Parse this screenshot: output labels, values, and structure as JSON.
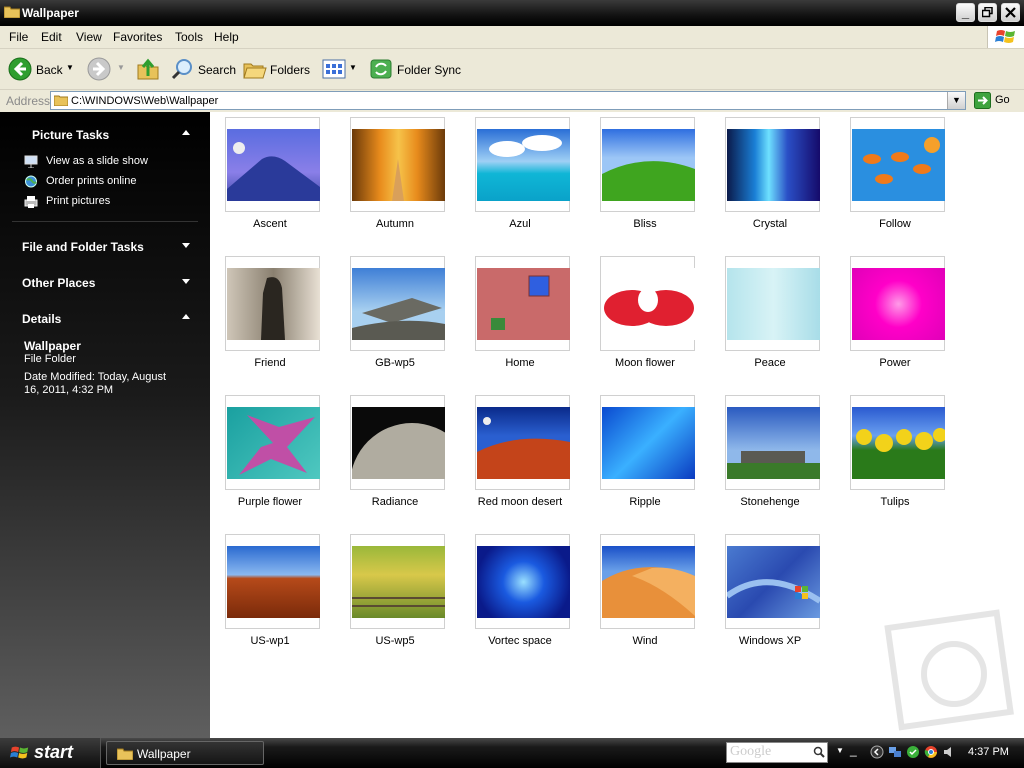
{
  "window": {
    "title": "Wallpaper"
  },
  "menu": [
    "File",
    "Edit",
    "View",
    "Favorites",
    "Tools",
    "Help"
  ],
  "toolbar": {
    "back_label": "Back",
    "search_label": "Search",
    "folders_label": "Folders",
    "sync_label": "Folder Sync"
  },
  "address": {
    "label": "Address",
    "value": "C:\\WINDOWS\\Web\\Wallpaper",
    "go_label": "Go"
  },
  "sidebar": {
    "picture_tasks": {
      "title": "Picture Tasks",
      "items": [
        "View as a slide show",
        "Order prints online",
        "Print pictures"
      ]
    },
    "file_folder_tasks": {
      "title": "File and Folder Tasks"
    },
    "other_places": {
      "title": "Other Places"
    },
    "details": {
      "title": "Details",
      "name": "Wallpaper",
      "type": "File Folder",
      "modified": "Date Modified: Today, August 16, 2011, 4:32 PM"
    }
  },
  "files": [
    "Ascent",
    "Autumn",
    "Azul",
    "Bliss",
    "Crystal",
    "Follow",
    "Friend",
    "GB-wp5",
    "Home",
    "Moon flower",
    "Peace",
    "Power",
    "Purple flower",
    "Radiance",
    "Red moon desert",
    "Ripple",
    "Stonehenge",
    "Tulips",
    "US-wp1",
    "US-wp5",
    "Vortec space",
    "Wind",
    "Windows XP"
  ],
  "taskbar": {
    "start_label": "start",
    "task_label": "Wallpaper",
    "search_brand": "Google",
    "clock": "4:37 PM"
  }
}
